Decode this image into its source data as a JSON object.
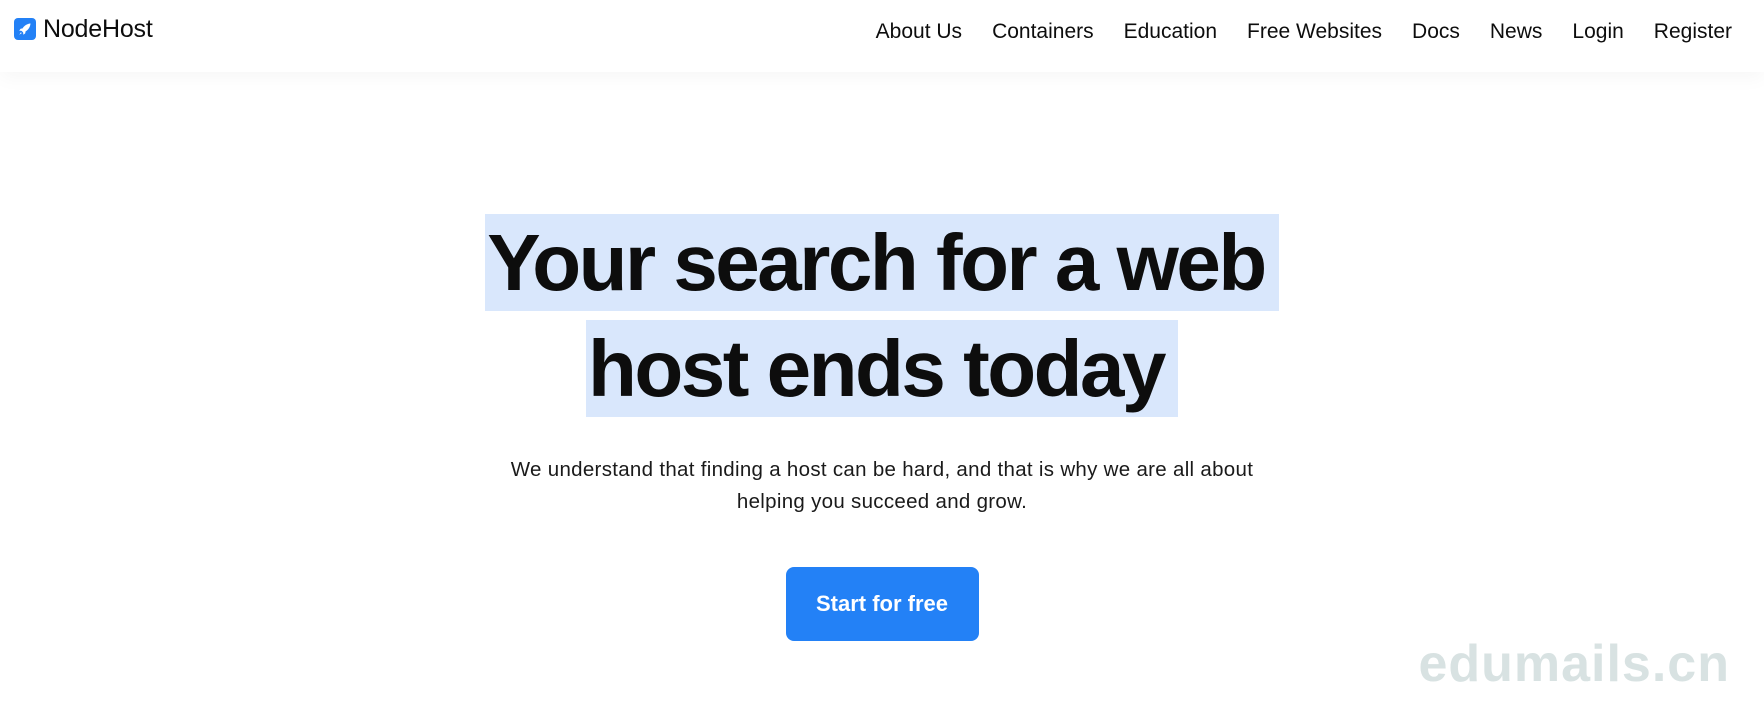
{
  "brand": {
    "name": "NodeHost",
    "icon": "rocket-icon",
    "icon_color": "#2381f6"
  },
  "nav": {
    "items": [
      {
        "label": "About Us"
      },
      {
        "label": "Containers"
      },
      {
        "label": "Education"
      },
      {
        "label": "Free Websites"
      },
      {
        "label": "Docs"
      },
      {
        "label": "News"
      },
      {
        "label": "Login"
      },
      {
        "label": "Register"
      }
    ]
  },
  "hero": {
    "headline": "Your search for a web host ends today",
    "subtitle": "We understand that finding a host can be hard, and that is why we are all about helping you succeed and grow.",
    "cta_label": "Start for free"
  },
  "watermark": {
    "text": "edumails.cn"
  },
  "colors": {
    "accent": "#2381f6",
    "highlight": "#d9e7fc",
    "watermark": "#d8e2e2"
  }
}
